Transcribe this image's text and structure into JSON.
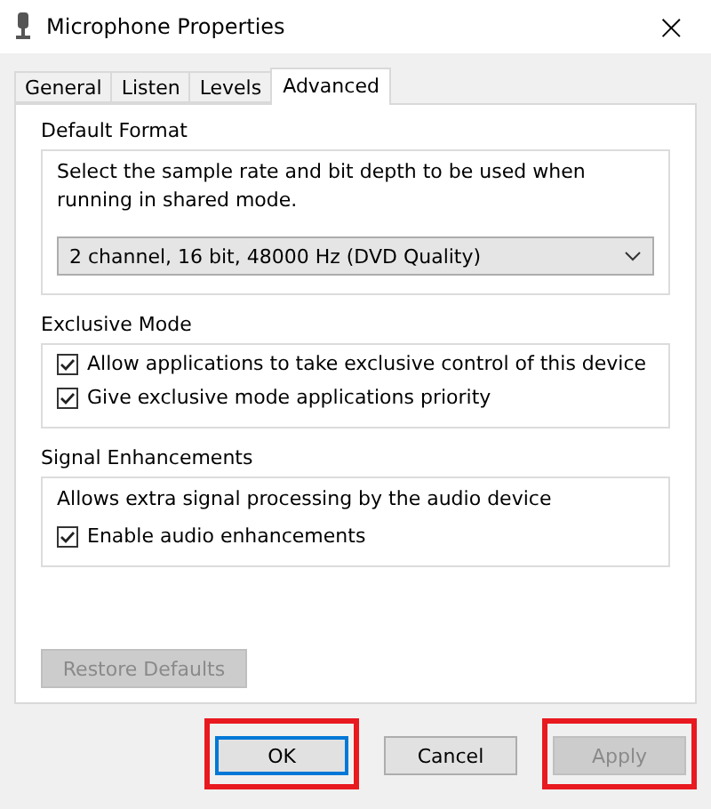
{
  "window": {
    "title": "Microphone Properties",
    "close": "×"
  },
  "tabs": [
    {
      "label": "General",
      "selected": false
    },
    {
      "label": "Listen",
      "selected": false
    },
    {
      "label": "Levels",
      "selected": false
    },
    {
      "label": "Advanced",
      "selected": true
    }
  ],
  "groups": [
    {
      "title": "Default Format",
      "items": [
        {
          "kind": "text",
          "text": "Select the sample rate and bit depth to be used when running in shared mode."
        },
        {
          "kind": "select",
          "value": "2 channel, 16 bit, 48000 Hz (DVD Quality)"
        }
      ]
    },
    {
      "title": "Exclusive Mode",
      "items": [
        {
          "kind": "checkbox",
          "label": "Allow applications to take exclusive control of this device",
          "checked": true
        },
        {
          "kind": "checkbox",
          "label": "Give exclusive mode applications priority",
          "checked": true
        }
      ]
    },
    {
      "title": "Signal Enhancements",
      "items": [
        {
          "kind": "text",
          "text": "Allows extra signal processing by the audio device"
        },
        {
          "kind": "checkbox",
          "label": "Enable audio enhancements",
          "checked": true
        }
      ]
    }
  ],
  "restore_button": {
    "label": "Restore Defaults",
    "disabled": true
  },
  "buttons": [
    {
      "label": "OK",
      "disabled": false,
      "focused": true,
      "highlighted": true
    },
    {
      "label": "Cancel",
      "disabled": false,
      "focused": false,
      "highlighted": false
    },
    {
      "label": "Apply",
      "disabled": true,
      "focused": false,
      "highlighted": true
    }
  ]
}
